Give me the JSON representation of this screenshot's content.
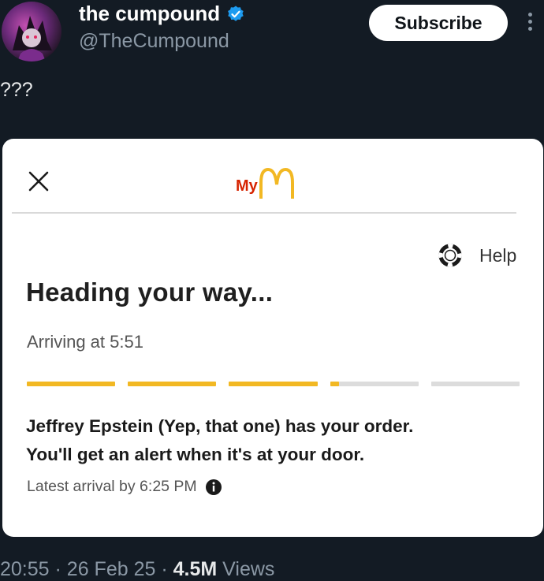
{
  "post": {
    "display_name": "the cumpound",
    "handle": "@TheCumpound",
    "subscribe_label": "Subscribe",
    "text": "???",
    "time": "20:55",
    "sep": "·",
    "date": "26 Feb 25",
    "views_count": "4.5M",
    "views_label": "Views"
  },
  "app": {
    "logo_prefix": "My",
    "help_label": "Help",
    "heading": "Heading your way...",
    "arriving": "Arriving at 5:51",
    "progress": {
      "completed_segments": 3,
      "total_segments": 5,
      "current_segment_fill": 0.1
    },
    "message_line1": "Jeffrey Epstein (Yep, that one) has your order.",
    "message_line2": "You'll get an alert when it's at your door.",
    "latest_arrival": "Latest arrival by 6:25 PM"
  },
  "icons": {
    "verified": "verified-badge-icon",
    "close": "close-icon",
    "help": "lifebuoy-icon",
    "info": "info-icon",
    "more": "more-vertical-icon"
  },
  "colors": {
    "background": "#131b24",
    "accent_yellow": "#f2b823",
    "progress_track": "#dcdcdc",
    "verified_blue": "#1d9bf0",
    "logo_red": "#d62300"
  }
}
